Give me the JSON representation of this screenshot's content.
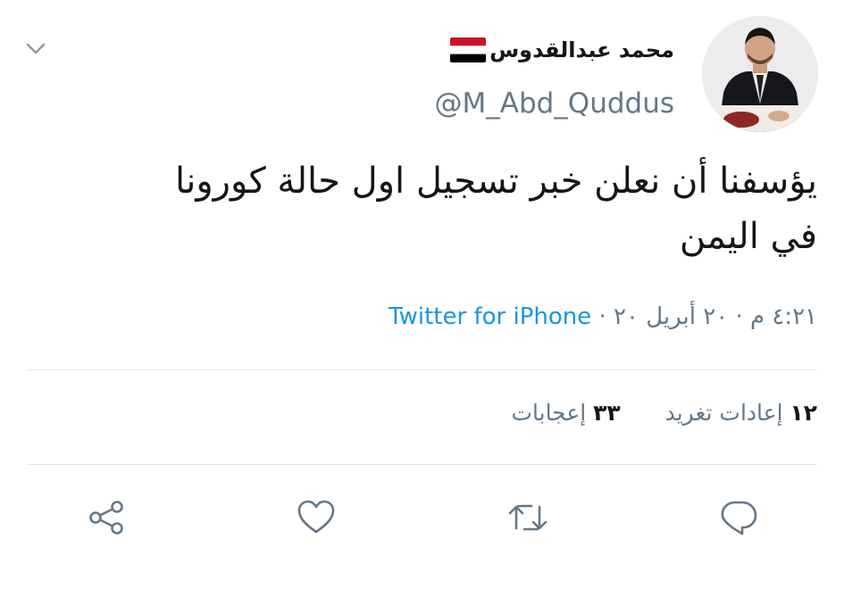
{
  "tweet": {
    "author_name": "محمد عبدالقدوس",
    "handle": "@M_Abd_Quddus",
    "text_line1": "يؤسفنا أن نعلن خبر تسجيل اول حالة كورونا",
    "text_line2": "في اليمن",
    "time": "٤:٢١ م",
    "date": "٢٠ أبريل ٢٠",
    "separator": "·",
    "source": "Twitter for iPhone"
  },
  "stats": {
    "retweets_count": "١٢",
    "retweets_label": "إعادات تغريد",
    "likes_count": "٣٣",
    "likes_label": "إعجابات"
  },
  "icons": {
    "menu": "chevron-down-icon",
    "reply": "reply-icon",
    "retweet": "retweet-icon",
    "like": "heart-icon",
    "share": "share-icon"
  },
  "colors": {
    "link": "#1b95e0",
    "secondary_text": "#657786",
    "divider": "#e1e8ed",
    "icon": "#657786",
    "flag_red": "#ce1126",
    "flag_white": "#ffffff",
    "flag_black": "#000000"
  }
}
